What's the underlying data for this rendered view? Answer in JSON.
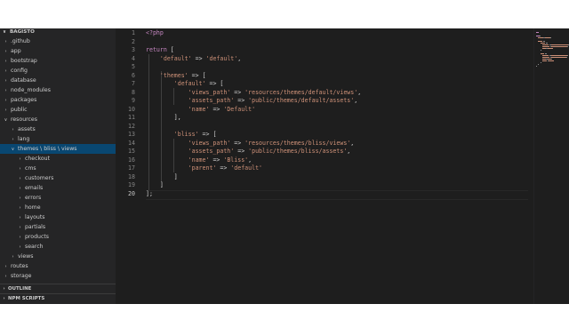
{
  "explorer": {
    "title": "BAGISTO",
    "title_chevron": "chevron-down",
    "items": [
      {
        "label": ".github",
        "depth": 1,
        "expanded": false
      },
      {
        "label": "app",
        "depth": 1,
        "expanded": false
      },
      {
        "label": "bootstrap",
        "depth": 1,
        "expanded": false
      },
      {
        "label": "config",
        "depth": 1,
        "expanded": false
      },
      {
        "label": "database",
        "depth": 1,
        "expanded": false
      },
      {
        "label": "node_modules",
        "depth": 1,
        "expanded": false
      },
      {
        "label": "packages",
        "depth": 1,
        "expanded": false
      },
      {
        "label": "public",
        "depth": 1,
        "expanded": false
      },
      {
        "label": "resources",
        "depth": 1,
        "expanded": true
      },
      {
        "label": "assets",
        "depth": 2,
        "expanded": false
      },
      {
        "label": "lang",
        "depth": 2,
        "expanded": false
      },
      {
        "label": "themes \\ bliss \\ views",
        "depth": 2,
        "expanded": true,
        "selected": true
      },
      {
        "label": "checkout",
        "depth": 3,
        "expanded": false
      },
      {
        "label": "cms",
        "depth": 3,
        "expanded": false
      },
      {
        "label": "customers",
        "depth": 3,
        "expanded": false
      },
      {
        "label": "emails",
        "depth": 3,
        "expanded": false
      },
      {
        "label": "errors",
        "depth": 3,
        "expanded": false
      },
      {
        "label": "home",
        "depth": 3,
        "expanded": false
      },
      {
        "label": "layouts",
        "depth": 3,
        "expanded": false
      },
      {
        "label": "partials",
        "depth": 3,
        "expanded": false
      },
      {
        "label": "products",
        "depth": 3,
        "expanded": false
      },
      {
        "label": "search",
        "depth": 3,
        "expanded": false
      },
      {
        "label": "views",
        "depth": 2,
        "expanded": false
      },
      {
        "label": "routes",
        "depth": 1,
        "expanded": false
      },
      {
        "label": "storage",
        "depth": 1,
        "expanded": false
      }
    ],
    "outline_label": "OUTLINE",
    "npm_label": "NPM SCRIPTS"
  },
  "editor": {
    "active_line": 20,
    "lines": [
      {
        "n": "1",
        "tokens": [
          {
            "t": "<?php",
            "c": "kw"
          }
        ]
      },
      {
        "n": "2",
        "tokens": []
      },
      {
        "n": "3",
        "tokens": [
          {
            "t": "return",
            "c": "kw"
          },
          {
            "t": " [",
            "c": "op"
          }
        ]
      },
      {
        "n": "4",
        "tokens": [
          {
            "t": "    ",
            "c": "op"
          },
          {
            "t": "'default'",
            "c": "str"
          },
          {
            "t": " => ",
            "c": "op"
          },
          {
            "t": "'default'",
            "c": "str"
          },
          {
            "t": ",",
            "c": "op"
          }
        ]
      },
      {
        "n": "5",
        "tokens": []
      },
      {
        "n": "6",
        "tokens": [
          {
            "t": "    ",
            "c": "op"
          },
          {
            "t": "'themes'",
            "c": "str"
          },
          {
            "t": " => [",
            "c": "op"
          }
        ]
      },
      {
        "n": "7",
        "tokens": [
          {
            "t": "        ",
            "c": "op"
          },
          {
            "t": "'default'",
            "c": "str"
          },
          {
            "t": " => [",
            "c": "op"
          }
        ]
      },
      {
        "n": "8",
        "tokens": [
          {
            "t": "            ",
            "c": "op"
          },
          {
            "t": "'views_path'",
            "c": "str"
          },
          {
            "t": " => ",
            "c": "op"
          },
          {
            "t": "'resources/themes/default/views'",
            "c": "str"
          },
          {
            "t": ",",
            "c": "op"
          }
        ]
      },
      {
        "n": "9",
        "tokens": [
          {
            "t": "            ",
            "c": "op"
          },
          {
            "t": "'assets_path'",
            "c": "str"
          },
          {
            "t": " => ",
            "c": "op"
          },
          {
            "t": "'public/themes/default/assets'",
            "c": "str"
          },
          {
            "t": ",",
            "c": "op"
          }
        ]
      },
      {
        "n": "10",
        "tokens": [
          {
            "t": "            ",
            "c": "op"
          },
          {
            "t": "'name'",
            "c": "str"
          },
          {
            "t": " => ",
            "c": "op"
          },
          {
            "t": "'Default'",
            "c": "str"
          }
        ]
      },
      {
        "n": "11",
        "tokens": [
          {
            "t": "        ],",
            "c": "op"
          }
        ]
      },
      {
        "n": "12",
        "tokens": []
      },
      {
        "n": "13",
        "tokens": [
          {
            "t": "        ",
            "c": "op"
          },
          {
            "t": "'bliss'",
            "c": "str"
          },
          {
            "t": " => [",
            "c": "op"
          }
        ]
      },
      {
        "n": "14",
        "tokens": [
          {
            "t": "            ",
            "c": "op"
          },
          {
            "t": "'views_path'",
            "c": "str"
          },
          {
            "t": " => ",
            "c": "op"
          },
          {
            "t": "'resources/themes/bliss/views'",
            "c": "str"
          },
          {
            "t": ",",
            "c": "op"
          }
        ]
      },
      {
        "n": "15",
        "tokens": [
          {
            "t": "            ",
            "c": "op"
          },
          {
            "t": "'assets_path'",
            "c": "str"
          },
          {
            "t": " => ",
            "c": "op"
          },
          {
            "t": "'public/themes/bliss/assets'",
            "c": "str"
          },
          {
            "t": ",",
            "c": "op"
          }
        ]
      },
      {
        "n": "16",
        "tokens": [
          {
            "t": "            ",
            "c": "op"
          },
          {
            "t": "'name'",
            "c": "str"
          },
          {
            "t": " => ",
            "c": "op"
          },
          {
            "t": "'Bliss'",
            "c": "str"
          },
          {
            "t": ",",
            "c": "op"
          }
        ]
      },
      {
        "n": "17",
        "tokens": [
          {
            "t": "            ",
            "c": "op"
          },
          {
            "t": "'parent'",
            "c": "str"
          },
          {
            "t": " => ",
            "c": "op"
          },
          {
            "t": "'default'",
            "c": "str"
          }
        ]
      },
      {
        "n": "18",
        "tokens": [
          {
            "t": "        ]",
            "c": "op"
          }
        ]
      },
      {
        "n": "19",
        "tokens": [
          {
            "t": "    ]",
            "c": "op"
          }
        ]
      },
      {
        "n": "20",
        "tokens": [
          {
            "t": "];",
            "c": "op"
          }
        ]
      }
    ]
  },
  "colors": {
    "keyword": "#c586c0",
    "string": "#ce9178",
    "selection": "#094771",
    "background": "#1e1e1e",
    "sidebar": "#252526"
  }
}
